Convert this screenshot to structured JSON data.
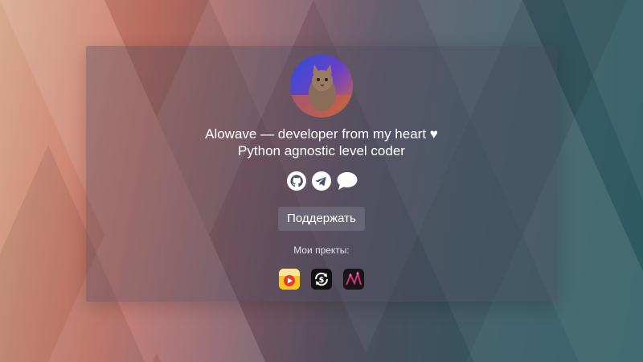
{
  "profile": {
    "name_line": "Alowave — developer from my heart ♥",
    "subtitle": "Python agnostic level coder",
    "avatar_alt": "cat-avatar"
  },
  "social": [
    {
      "icon": "github-icon"
    },
    {
      "icon": "telegram-icon"
    },
    {
      "icon": "chat-bubble-icon"
    }
  ],
  "support_button": {
    "label": "Поддержать"
  },
  "projects": {
    "label": "Мои пректы:",
    "items": [
      {
        "icon": "yellow-play-app-icon"
      },
      {
        "icon": "dollar-refresh-app-icon"
      },
      {
        "icon": "dark-pink-app-icon"
      }
    ]
  },
  "colors": {
    "background_left": "#c87466",
    "background_right": "#2c5a62",
    "card_overlay": "#46465a",
    "text": "#ffffff"
  }
}
